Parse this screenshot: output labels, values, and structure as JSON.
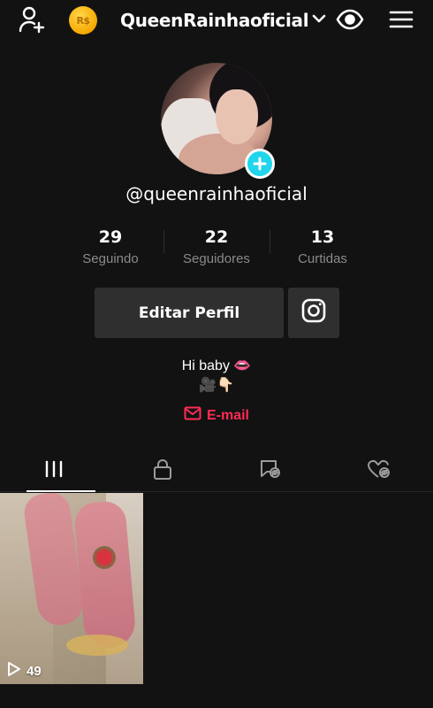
{
  "header": {
    "coin_label": "R$",
    "username": "QueenRainhaoficial"
  },
  "profile": {
    "handle": "@queenrainhaoficial",
    "stats": [
      {
        "value": "29",
        "label": "Seguindo"
      },
      {
        "value": "22",
        "label": "Seguidores"
      },
      {
        "value": "13",
        "label": "Curtidas"
      }
    ],
    "edit_button": "Editar Perfil",
    "bio_line1": "Hi baby 👄",
    "bio_line2": "🎥👇🏻",
    "email_label": "E-mail"
  },
  "tabs": [
    {
      "icon": "videos-grid-icon",
      "active": true
    },
    {
      "icon": "lock-icon",
      "active": false
    },
    {
      "icon": "hidden-reposts-icon",
      "active": false
    },
    {
      "icon": "liked-hidden-icon",
      "active": false
    }
  ],
  "videos": [
    {
      "views": "49"
    }
  ],
  "colors": {
    "background": "#121212",
    "accent_red": "#fe2c55",
    "accent_cyan": "#20d5ec",
    "button_bg": "#2f2f2f",
    "muted_text": "#8a8a8a"
  }
}
